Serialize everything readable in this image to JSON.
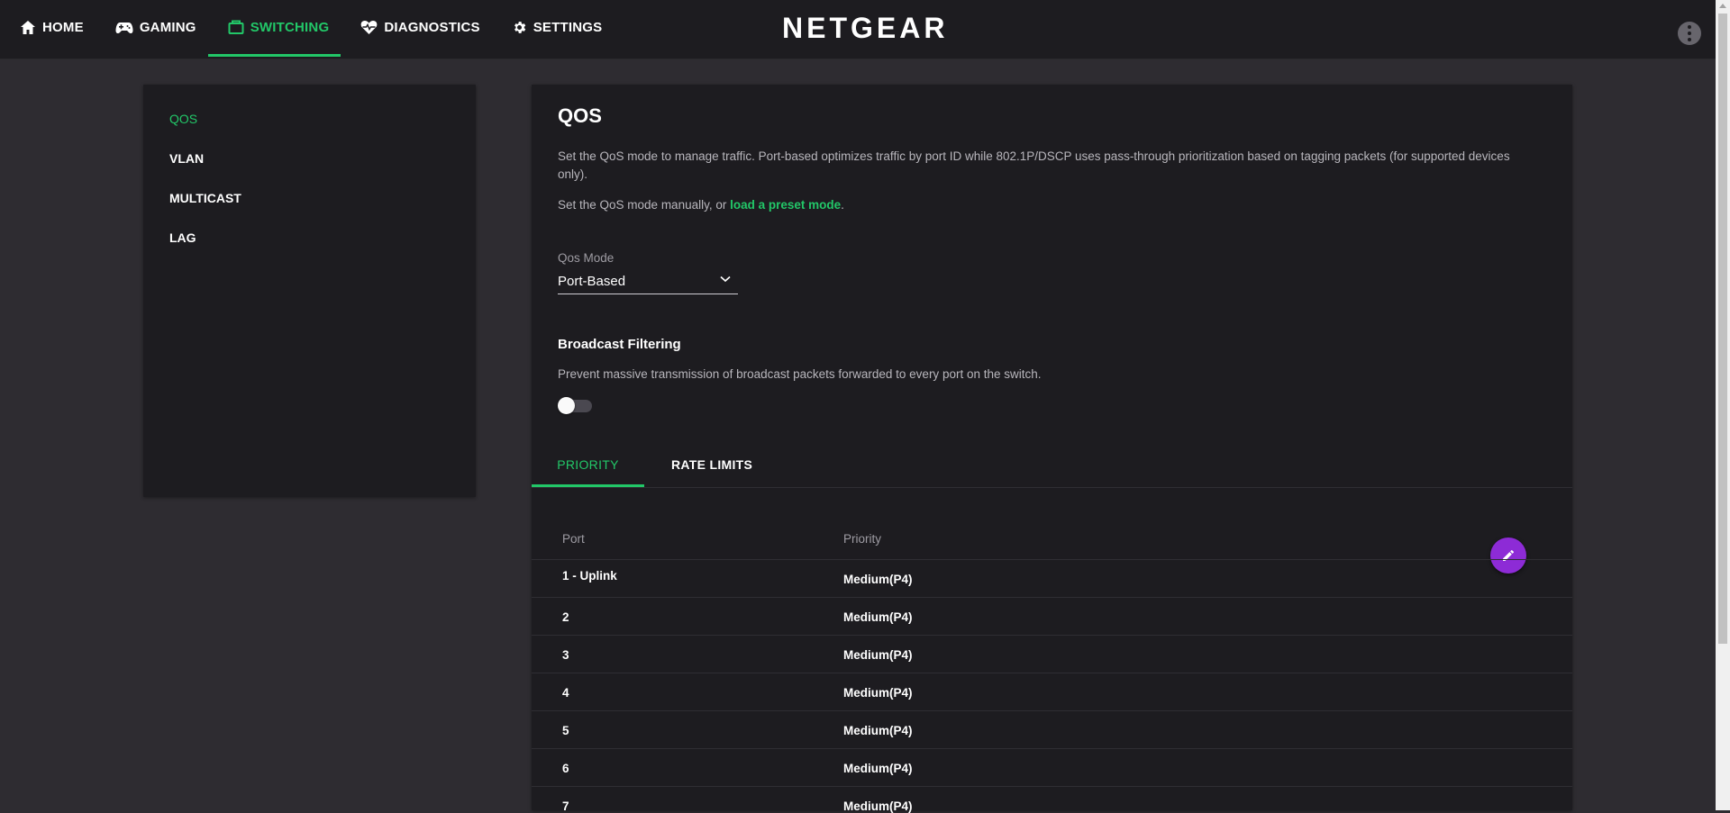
{
  "topbar": {
    "nav": [
      {
        "label": "HOME",
        "icon": "home-icon"
      },
      {
        "label": "GAMING",
        "icon": "gamepad-icon"
      },
      {
        "label": "SWITCHING",
        "icon": "switch-icon",
        "active": true
      },
      {
        "label": "DIAGNOSTICS",
        "icon": "heart-pulse-icon"
      },
      {
        "label": "SETTINGS",
        "icon": "gear-icon"
      }
    ],
    "brand": "NETGEAR",
    "more_icon": "more-vertical-icon"
  },
  "sidebar": {
    "items": [
      {
        "label": "QOS",
        "active": true
      },
      {
        "label": "VLAN"
      },
      {
        "label": "MULTICAST"
      },
      {
        "label": "LAG"
      }
    ]
  },
  "main": {
    "title": "QOS",
    "description": "Set the QoS mode to manage traffic. Port-based optimizes traffic by port ID while 802.1P/DSCP uses pass-through prioritization based on tagging packets (for supported devices only).",
    "manual_text": "Set the QoS mode manually, or ",
    "preset_link": "load a preset mode",
    "manual_suffix": ".",
    "qos_mode_label": "Qos Mode",
    "qos_mode_value": "Port-Based",
    "broadcast_title": "Broadcast Filtering",
    "broadcast_desc": "Prevent massive transmission of broadcast packets forwarded to every port on the switch.",
    "broadcast_enabled": false,
    "tabs": [
      {
        "label": "PRIORITY",
        "active": true
      },
      {
        "label": "RATE LIMITS"
      }
    ],
    "table": {
      "headers": {
        "port": "Port",
        "priority": "Priority"
      },
      "rows": [
        {
          "port": "1 - Uplink",
          "priority": "Medium(P4)"
        },
        {
          "port": "2",
          "priority": "Medium(P4)"
        },
        {
          "port": "3",
          "priority": "Medium(P4)"
        },
        {
          "port": "4",
          "priority": "Medium(P4)"
        },
        {
          "port": "5",
          "priority": "Medium(P4)"
        },
        {
          "port": "6",
          "priority": "Medium(P4)"
        },
        {
          "port": "7",
          "priority": "Medium(P4)"
        }
      ]
    },
    "edit_icon": "pencil-icon"
  },
  "colors": {
    "accent": "#22c768",
    "fab": "#8d2bd6",
    "panel": "#1d1c20",
    "background": "#2e2c31"
  }
}
